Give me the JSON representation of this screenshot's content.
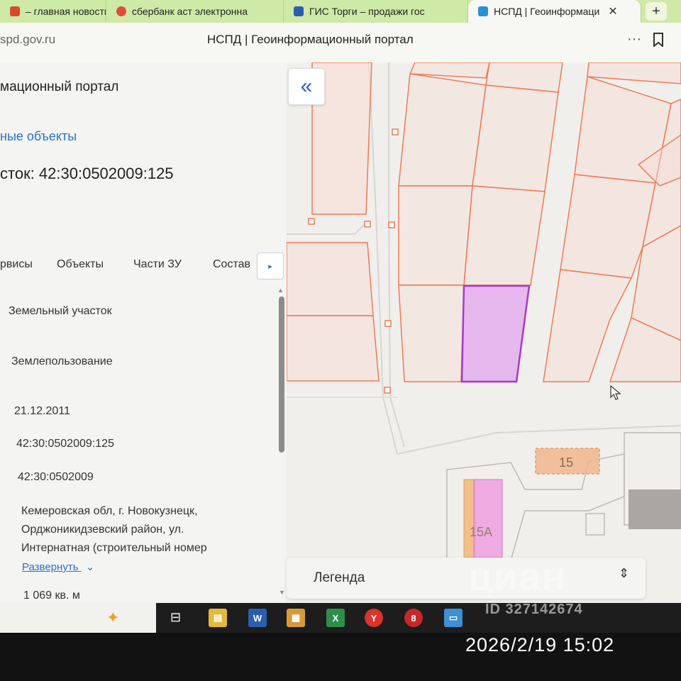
{
  "browser": {
    "tabs": [
      {
        "label": "– главная новостна",
        "color": "#d94a2b",
        "active": false
      },
      {
        "label": "сбербанк аст электронна",
        "color": "#e24b3b",
        "active": false
      },
      {
        "label": "ГИС Торги – продажи гос",
        "color": "#2b5fae",
        "active": false
      },
      {
        "label": "НСПД | Геоинформаци",
        "color": "#2a8fd6",
        "active": true
      }
    ],
    "new_tab": "+",
    "close_glyph": "✕",
    "url": "spd.gov.ru",
    "page_title": "НСПД | Геоинформационный портал",
    "menu_glyph": "···"
  },
  "panel": {
    "title": "мационный портал",
    "section_link": "ные объекты",
    "heading": "сток: 42:30:0502009:125",
    "tabs": [
      "рвисы",
      "Объекты",
      "Части ЗУ",
      "Состав"
    ],
    "next_glyph": "▸",
    "fields": [
      "Земельный участок",
      "Землепользование",
      "21.12.2011",
      "42:30:0502009:125",
      "42:30:0502009"
    ],
    "address_lines": [
      "Кемеровская обл, г. Новокузнецк,",
      "Орджоникидзевский район, ул.",
      "Интернатная (строительный номер"
    ],
    "expand_label": "Развернуть",
    "area": "1 069 кв. м"
  },
  "map": {
    "collapse_glyph": "«",
    "labels": [
      "15",
      "15А"
    ],
    "legend_title": "Легенда",
    "legend_toggle": "⇕",
    "colors": {
      "parcel_line": "#f07a55",
      "parcel_fill": "#f7dcd4",
      "selected_line": "#a23cc8",
      "selected_fill": "#e6b8ee",
      "building": "#f2b38a",
      "building_b": "#ef9fe0"
    }
  },
  "taskbar": {
    "apps": [
      {
        "name": "file-manager",
        "glyph": "▤",
        "color": "#e6b93a"
      },
      {
        "name": "word",
        "glyph": "W",
        "color": "#2b5fae"
      },
      {
        "name": "folder",
        "glyph": "▦",
        "color": "#d79b3c"
      },
      {
        "name": "excel",
        "glyph": "X",
        "color": "#2f8f4a"
      },
      {
        "name": "yandex-browser",
        "glyph": "Y",
        "color": "#d9342b"
      },
      {
        "name": "app-red",
        "glyph": "8",
        "color": "#c62828"
      },
      {
        "name": "scanner",
        "glyph": "▭",
        "color": "#3f8fd6"
      }
    ]
  },
  "overlay": {
    "watermark": "циан",
    "watermark_id": "ID 327142674",
    "timestamp": "2026/2/19 15:02"
  }
}
